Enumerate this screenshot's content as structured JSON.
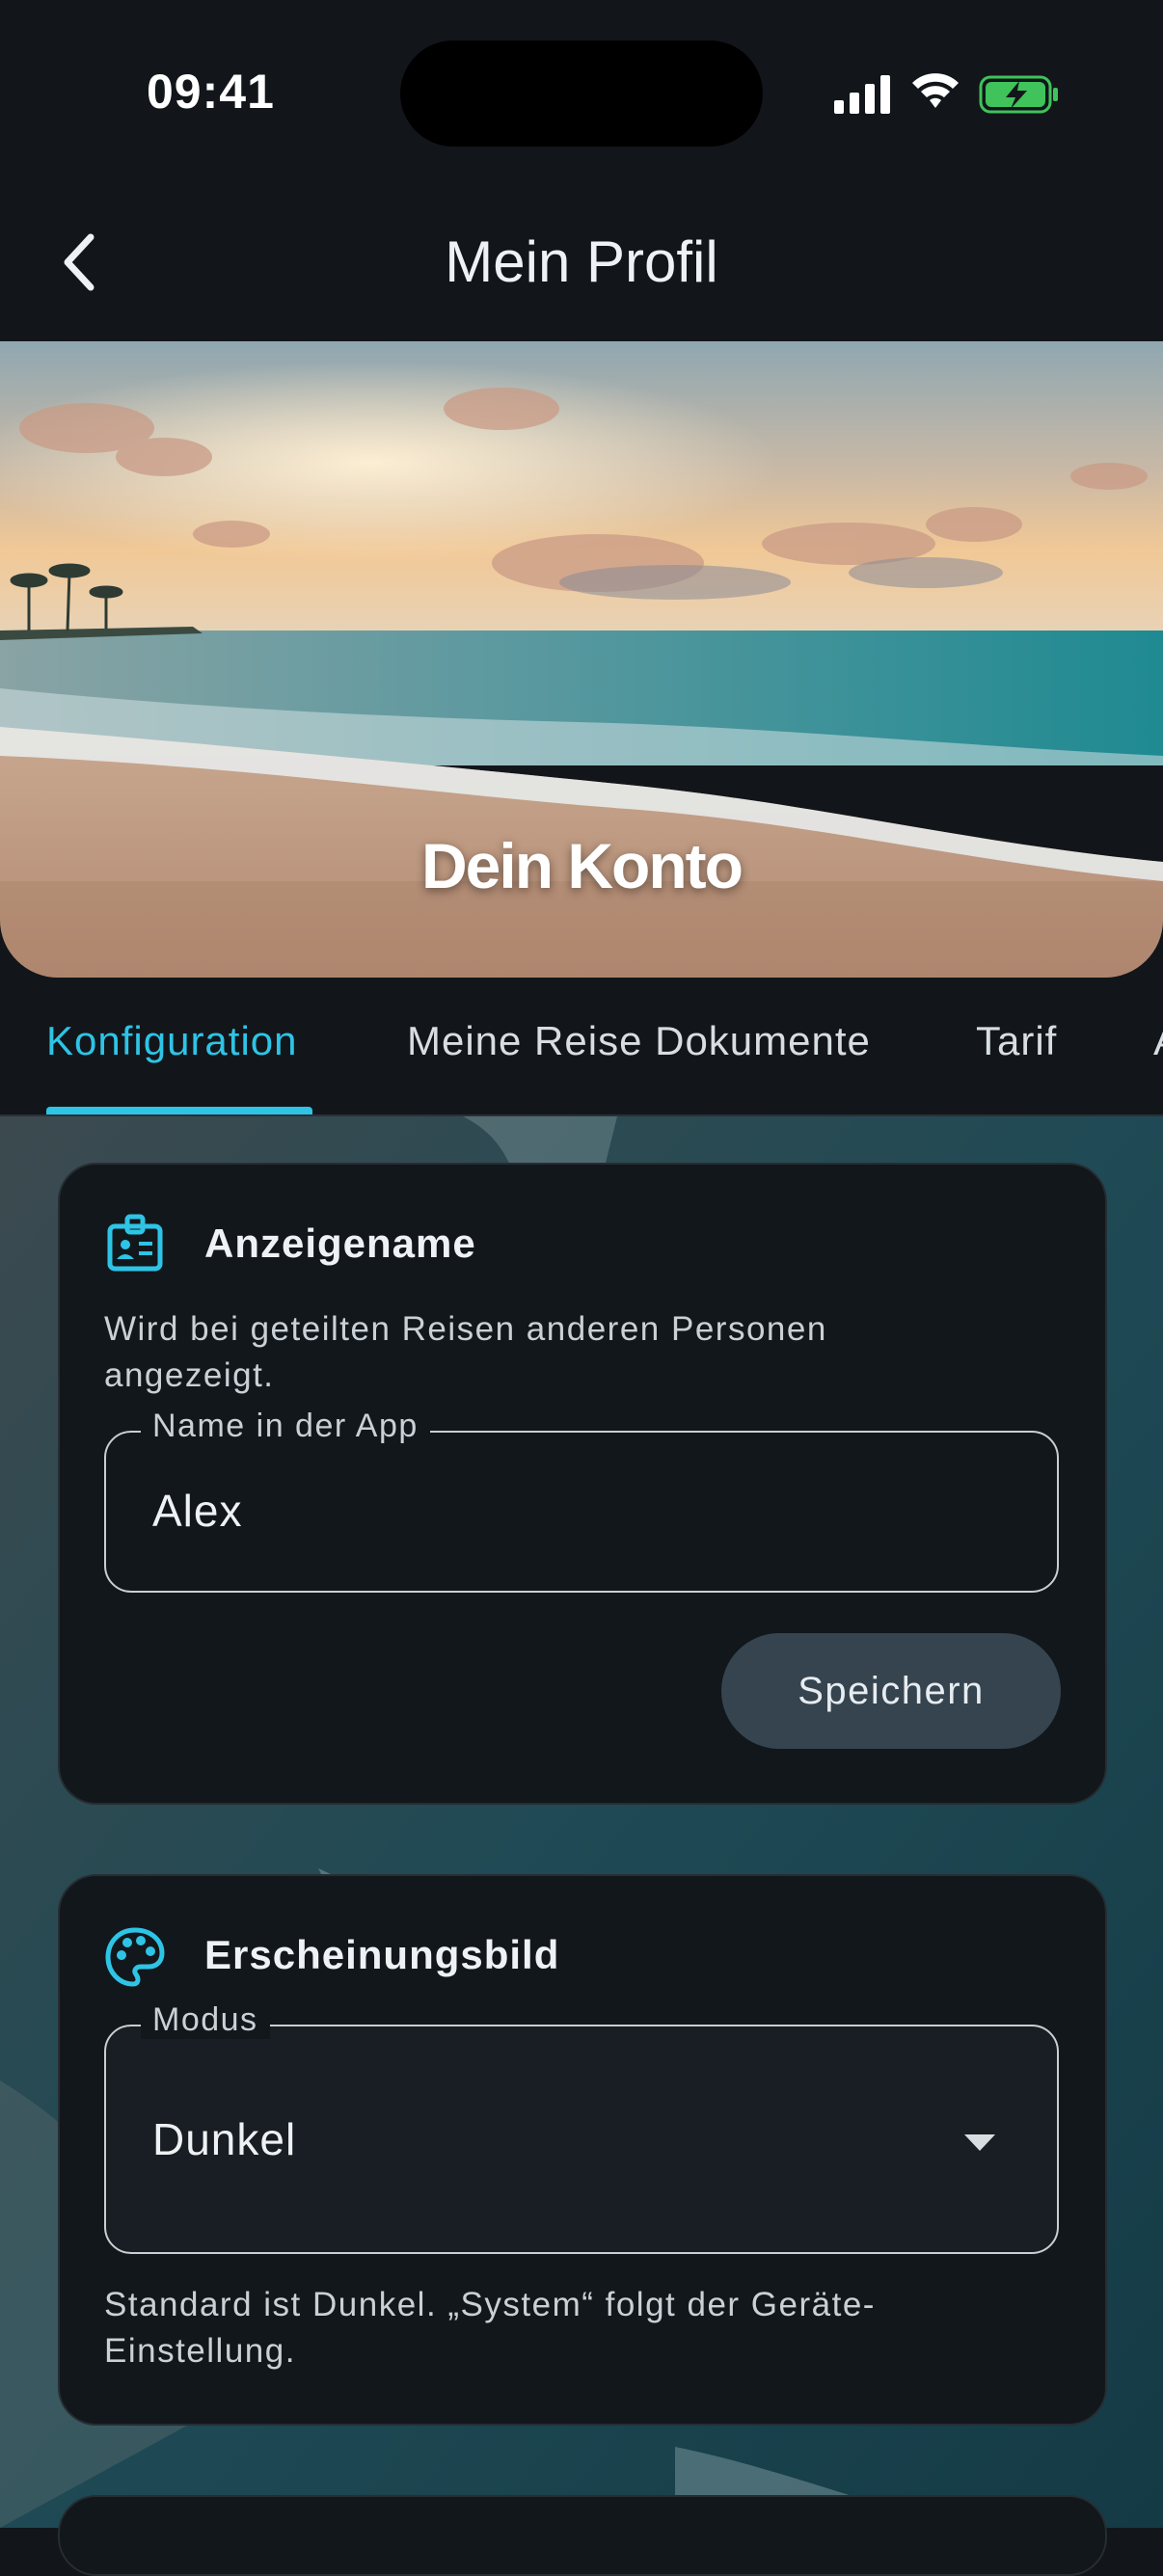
{
  "status_bar": {
    "time": "09:41"
  },
  "header": {
    "title": "Mein Profil",
    "back_icon": "chevron-left-icon"
  },
  "hero": {
    "title": "Dein Konto"
  },
  "tabs": [
    {
      "label": "Konfiguration",
      "active": true
    },
    {
      "label": "Meine Reise Dokumente",
      "active": false
    },
    {
      "label": "Tarif",
      "active": false
    },
    {
      "label": "A",
      "active": false
    }
  ],
  "display_name_card": {
    "icon": "id-badge-icon",
    "title": "Anzeigename",
    "description_line1": "Wird bei geteilten Reisen anderen Personen",
    "description_line2": "angezeigt.",
    "field_label": "Name in der App",
    "field_value": "Alex",
    "save_label": "Speichern"
  },
  "appearance_card": {
    "icon": "palette-icon",
    "title": "Erscheinungsbild",
    "field_label": "Modus",
    "selected_value": "Dunkel",
    "hint_line1": "Standard ist Dunkel. „System“ folgt der Geräte-",
    "hint_line2": "Einstellung."
  },
  "colors": {
    "accent": "#2ec4e6",
    "background": "#12161a",
    "card": "#12171b",
    "button": "#36444f"
  }
}
